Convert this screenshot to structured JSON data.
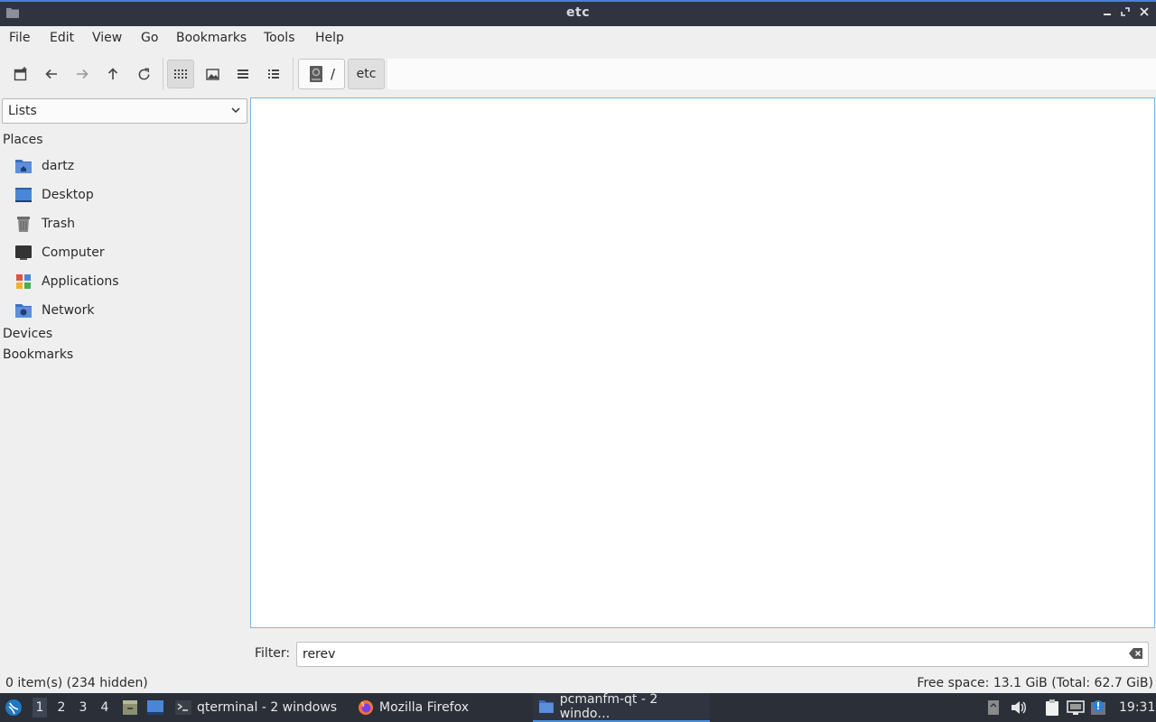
{
  "window": {
    "title": "etc"
  },
  "menubar": [
    "File",
    "Edit",
    "View",
    "Go",
    "Bookmarks",
    "Tools",
    "Help"
  ],
  "toolbar": {
    "path_root": "/",
    "path_current": "etc"
  },
  "sidepane": {
    "selector": "Lists",
    "places_header": "Places",
    "places": [
      {
        "label": "dartz",
        "icon": "home-folder-icon"
      },
      {
        "label": "Desktop",
        "icon": "desktop-icon"
      },
      {
        "label": "Trash",
        "icon": "trash-icon"
      },
      {
        "label": "Computer",
        "icon": "computer-icon"
      },
      {
        "label": "Applications",
        "icon": "applications-icon"
      },
      {
        "label": "Network",
        "icon": "network-folder-icon"
      }
    ],
    "devices_header": "Devices",
    "bookmarks_header": "Bookmarks"
  },
  "filter": {
    "label": "Filter:",
    "value": "rerev"
  },
  "status": {
    "items": "0 item(s) (234 hidden)",
    "free_space": "Free space: 13.1 GiB (Total: 62.7 GiB)"
  },
  "taskbar": {
    "workspaces": [
      "1",
      "2",
      "3",
      "4"
    ],
    "tasks": [
      {
        "label": "qterminal - 2 windows",
        "icon": "terminal-icon"
      },
      {
        "label": "Mozilla Firefox",
        "icon": "firefox-icon"
      },
      {
        "label": "pcmanfm-qt - 2 windo…",
        "icon": "file-manager-icon"
      }
    ],
    "clock": "19:31"
  },
  "colors": {
    "accent": "#4c7fd8",
    "titlebar": "#2f343f",
    "taskbar": "#2b2f38",
    "view_border": "#7fb4dd"
  }
}
